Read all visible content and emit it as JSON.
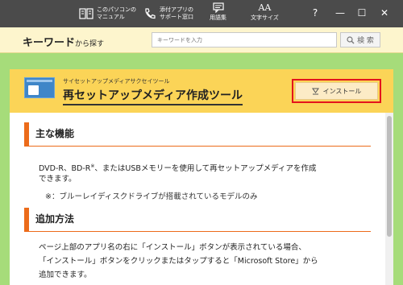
{
  "topbar": {
    "manual": {
      "line1": "このパソコンの",
      "line2": "マニュアル",
      "icon": "book-icon"
    },
    "support": {
      "line1": "添付アプリの",
      "line2": "サポート窓口",
      "icon": "phone-icon"
    },
    "glossary": {
      "label": "用語集",
      "icon": "chat-icon"
    },
    "font_size": {
      "label": "文字サイズ",
      "glyph": "AA"
    },
    "help": "?",
    "minimize": "—",
    "maximize": "☐",
    "close": "✕"
  },
  "search": {
    "title": "キーワード",
    "title_suffix": "から探す",
    "placeholder": "キーワードを入力",
    "button_label": "検 索"
  },
  "app": {
    "subtitle": "サイセットアップメディアサクセイツール",
    "title": "再セットアップメディア作成ツール",
    "install_label": "インストール"
  },
  "sections": [
    {
      "heading": "主な機能",
      "lines": [
        {
          "pre": "DVD-R、BD-R",
          "sup": "※",
          "post": "、またはUSBメモリーを使用して再セットアップメディアを作成"
        },
        {
          "pre": "できます。"
        }
      ],
      "note": "※：ブルーレイディスクドライブが搭載されているモデルのみ"
    },
    {
      "heading": "追加方法",
      "lines": [
        {
          "pre": "ページ上部のアプリ名の右に「インストール」ボタンが表示されている場合、"
        },
        {
          "pre": "「インストール」ボタンをクリックまたはタップすると「Microsoft Store」から"
        },
        {
          "pre": "追加できます。"
        }
      ]
    }
  ],
  "colors": {
    "background": "#a6dc7a",
    "topbar": "#4b4b4b",
    "header_yellow": "#fbd457",
    "accent_orange": "#ec6b1a",
    "highlight_red": "#e4141c"
  }
}
